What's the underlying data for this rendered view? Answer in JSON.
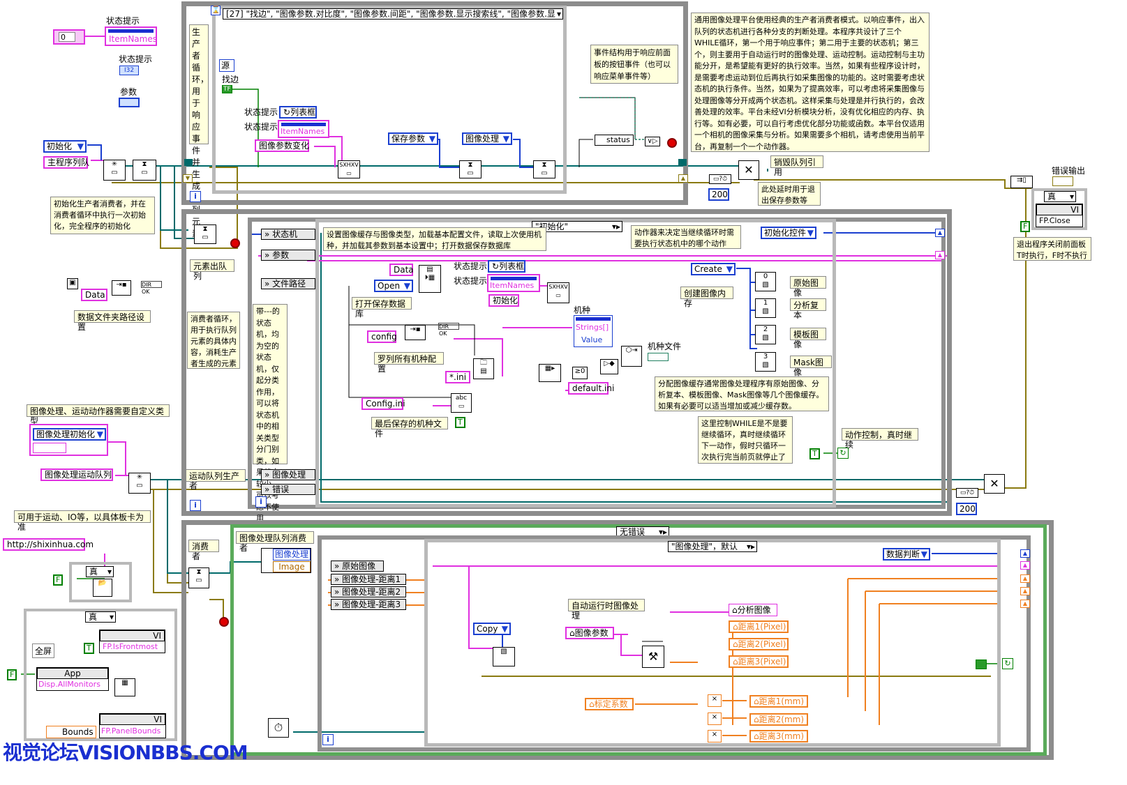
{
  "colors": {
    "loop_border": "#8c8c8c",
    "frame_border": "#b9b9b9",
    "pink": "#e030e0",
    "blue": "#1a3fd0",
    "orange": "#f08020",
    "green": "#008000",
    "note_bg": "#ffffdd",
    "watermark": "#1a2fd0"
  },
  "top_left": {
    "status_hint_1": "状态提示",
    "item_names": "ItemNames",
    "zero": "0",
    "status_hint_2": "状态提示",
    "i32": "I32",
    "param_label": "参数",
    "init_enum": "初始化",
    "main_queue": "主程序列队",
    "init_note": "初始化生产者消费者，并在消费者循环中执行一次初始化，完全程序的初始化",
    "data_const": "Data",
    "data_path_note": "数据文件夹路径设置",
    "dir_ok": "DIR OK",
    "img_define_note": "图像处理、运动动作器需要自定义类型",
    "img_init_enum": "图像处理初始化",
    "img_motion_queue": "图像处理运动队列",
    "motion_note": "可用于运动、IO等，以具体板卡为准",
    "url": "http://shixinhua.com",
    "true_case": "真",
    "f_const": "F",
    "t_const": "T",
    "fullscreen": "全屏",
    "vi_label": "VI",
    "fp_isfrontmost": "FP.IsFrontmost",
    "app_label": "App",
    "disp_allmonitors": "Disp.AllMonitors",
    "bounds": "Bounds",
    "fp_panelbounds": "FP.PanelBounds"
  },
  "producer_loop": {
    "side_label": "生产者循环，用于响应事件并生成队列元素",
    "event_selector": "[27] \"找边\", \"图像参数.对比度\", \"图像参数.间距\", \"图像参数.显示搜索线\", \"图像参数.显",
    "source": "源",
    "find_edge": "找边",
    "status_hint_a": "状态提示",
    "list_box": "列表框",
    "status_hint_b": "状态提示",
    "item_names": "ItemNames",
    "img_param_changed": "图像参数变化",
    "save_params": "保存参数",
    "img_process": "图像处理",
    "status": "status",
    "event_note": "事件结构用于响应前面板的按钮事件（也可以响应菜单事件等）",
    "i_term": "i"
  },
  "top_note": "通用图像处理平台使用经典的生产者消费者模式。以响应事件，出入队列的状态机进行各种分支的判断处理。本程序共设计了三个WHILE循环，第一个用于响应事件；第二用于主要的状态机；第三个，则主要用于自动运行时的图像处理、运动控制。运动控制与主功能分开，是希望能有更好的执行效率。当然，如果有些程序设计时，是需要考虑运动到位后再执行如采集图像的功能的。这时需要考虑状态机的执行条件。当然，如果为了提高效率，可以考虑将采集图像与处理图像等分开成两个状态机。这样采集与处理是并行执行的，会改善处理的效率。平台未经VI分析模块分析，没有优化相应的内存、执行等。如有必要，可以自行考虑优化部分功能或函数。本平台仅适用一个相机的图像采集与分析。如果需要多个相机，请考虑使用当前平台，再复制一个一个动作器。",
  "right_top": {
    "destroy_queue": "销毁队列引用",
    "delay_note": "此处延时用于退出保存参数等",
    "n200": "200",
    "error_out": "错误输出",
    "true_case": "真",
    "vi_label": "VI",
    "fp_close": "FP.Close",
    "f_const": "F",
    "exit_note": "退出程序关闭前面板T时执行，F时不执行"
  },
  "consumer_loop": {
    "dequeue_label": "元素出队列",
    "side_label": "消费者循环，用于执行队列元素的具体内容，消耗生产者生成的元素",
    "sm_note": "带---的状态机，均为空的状态机，仅起分类作用，可以将状态机中的相关类型分门别类，如果状态较少，可以考虑不使用",
    "shift_state": "状态机",
    "shift_params": "参数",
    "shift_filepath": "文件路径",
    "shift_imgproc": "图像处理",
    "shift_error": "错误",
    "motion_producer": "运动队列生产者",
    "case_selector": "\"初始化\"",
    "init_note": "设置图像缓存与图像类型，加载基本配置文件，读取上次使用机种，并加载其参数到基本设置中；打开数据保存数据库",
    "data": "Data",
    "open": "Open",
    "open_db": "打开保存数据库",
    "status_hint_a": "状态提示",
    "list_box": "列表框",
    "status_hint_b": "状态提示",
    "item_names": "ItemNames",
    "init": "初始化",
    "model_label": "机种",
    "strings": "Strings[]",
    "value": "Value",
    "config": "config",
    "dir_ok": "DIR OK",
    "list_models": "罗列所有机种配置",
    "ini_pattern": "*.ini",
    "default_ini": "default.ini",
    "model_file": "机种文件",
    "config_ini": "Config.ini",
    "last_model_file": "最后保存的机种文件",
    "t_const": "T",
    "actor_note": "动作器来决定当继续循环时需要执行状态机中的哪个动作",
    "init_control": "初始化控件",
    "create": "Create",
    "create_buffer": "创建图像内存",
    "buf_labels": [
      "原始图像",
      "分析复本",
      "模板图像",
      "Mask图像"
    ],
    "buf_indices": [
      "0",
      "1",
      "2",
      "3"
    ],
    "buffer_note": "分配图像缓存通常图像处理程序有原始图像、分析复本、模板图像、Mask图像等几个图像缓存。如果有必要可以适当增加或减少缓存数。",
    "while_note": "这里控制WHILE是不是要继续循环，真时继续循环下一动作，假时只循环一次执行完当前页就停止了",
    "motion_control": "动作控制，真时继续",
    "n200": "200",
    "i_term": "i"
  },
  "img_loop": {
    "consumer": "消费者",
    "queue_consumer": "图像处理队列消费者",
    "img_process": "图像处理",
    "image": "Image",
    "no_error": "无错误",
    "case_selector": "\"图像处理\"，默认",
    "raw_image": "原始图像",
    "dist1": "图像处理-距离1",
    "dist2": "图像处理-距离2",
    "dist3": "图像处理-距离3",
    "data_judge": "数据判断",
    "auto_process": "自动运行时图像处理",
    "copy": "Copy",
    "img_params": "图像参数",
    "analyze_image": "分析图像",
    "dist1_px": "距离1(Pixel)",
    "dist2_px": "距离2(Pixel)",
    "dist3_px": "距离3(Pixel)",
    "calib_coef": "标定系数",
    "dist1_mm": "距离1(mm)",
    "dist2_mm": "距离2(mm)",
    "dist3_mm": "距离3(mm)",
    "i_term": "i"
  },
  "watermark": "视觉论坛VISIONBBS.COM"
}
